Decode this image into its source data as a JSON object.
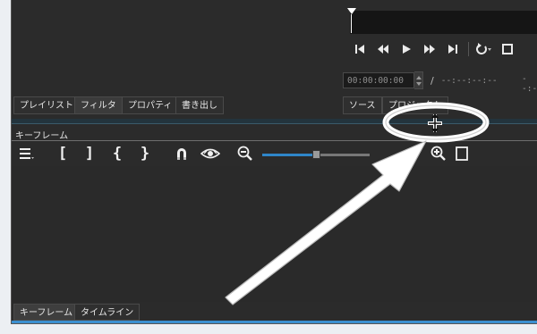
{
  "timecode": {
    "current": "00:00:00:00",
    "separator": "/",
    "total": "--:--:--:--",
    "right_fragment": "--:-"
  },
  "tabs": [
    {
      "label": "プレイリスト"
    },
    {
      "label": "フィルタ"
    },
    {
      "label": "プロパティ"
    },
    {
      "label": "書き出し"
    }
  ],
  "source_tabs": [
    {
      "label": "ソース"
    },
    {
      "label": "プロジェクト"
    }
  ],
  "keyframes_panel": {
    "title": "キーフレーム",
    "brackets": {
      "in": "[",
      "out": "]",
      "brace_in": "{",
      "brace_out": "}"
    },
    "zoom_level": 0.5
  },
  "bottom_tabs": [
    {
      "label": "キーフレーム"
    },
    {
      "label": "タイムライン"
    }
  ],
  "colors": {
    "accent": "#3b8fd0",
    "zoom_fill": "#2f86c9",
    "panel_bg": "#2b2b2b"
  }
}
